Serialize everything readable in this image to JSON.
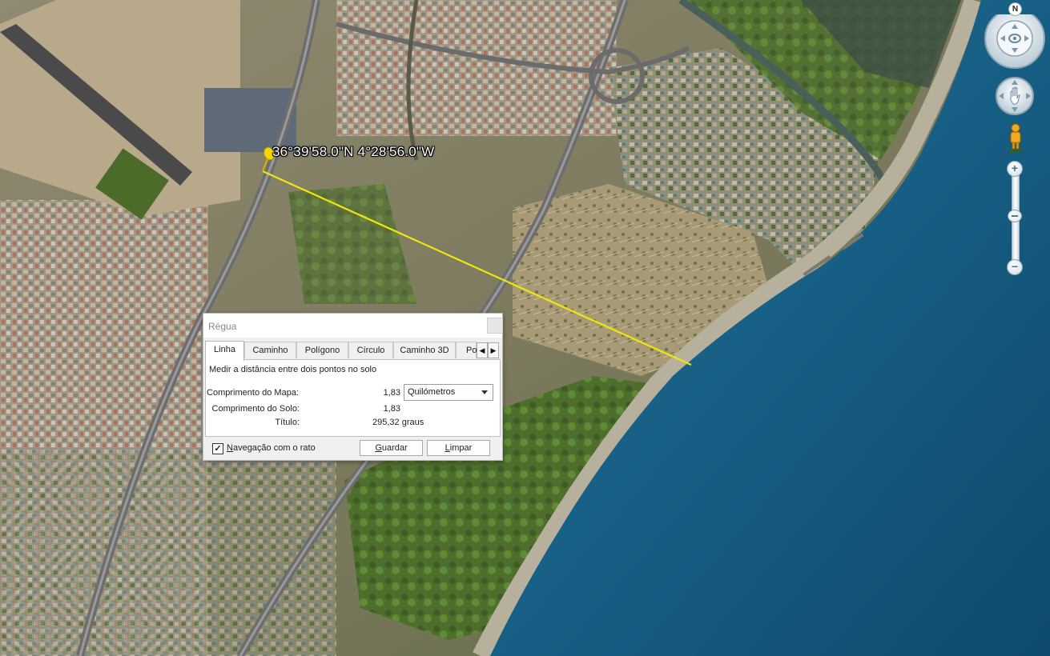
{
  "map": {
    "coordinates_label": "36°39'58.0\"N 4°28'56.0\"W",
    "line_color": "#f0e60a"
  },
  "nav_controls": {
    "north_label": "N",
    "zoom_plus": "+",
    "zoom_minus": "−",
    "zoom_level_fraction": 0.5
  },
  "dialog": {
    "title": "Régua",
    "tabs": [
      {
        "label": "Linha",
        "active": true
      },
      {
        "label": "Caminho",
        "active": false
      },
      {
        "label": "Polígono",
        "active": false
      },
      {
        "label": "Círculo",
        "active": false
      },
      {
        "label": "Caminho 3D",
        "active": false
      },
      {
        "label": "Po",
        "active": false
      }
    ],
    "description": "Medir a distância entre dois pontos no solo",
    "map_length_label": "Comprimento do Mapa:",
    "map_length_value": "1,83",
    "unit_select": {
      "value": "Quilómetros"
    },
    "ground_length_label": "Comprimento do Solo:",
    "ground_length_value": "1,83",
    "heading_label": "Título:",
    "heading_value": "295,32 graus",
    "mouse_nav_checked": true,
    "mouse_nav_label": "Navegação com o rato",
    "save_label": "Guardar",
    "clear_label": "Limpar"
  }
}
